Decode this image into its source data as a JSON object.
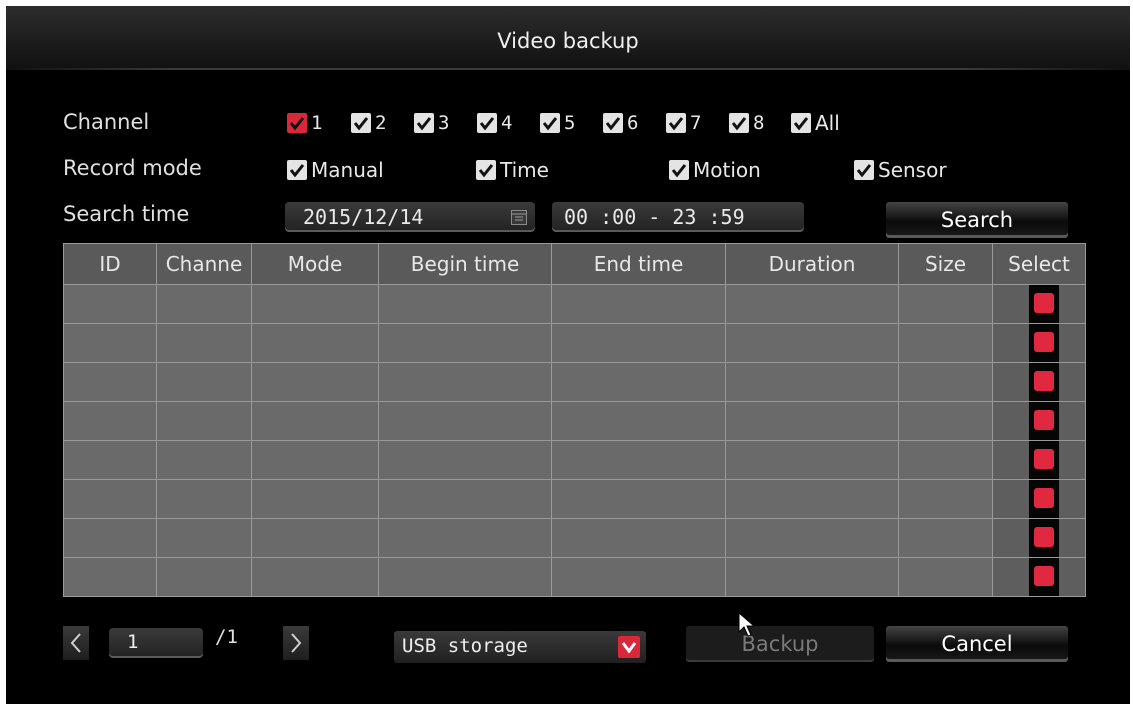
{
  "window": {
    "title": "Video backup"
  },
  "channel": {
    "label": "Channel",
    "items": [
      {
        "label": "1",
        "checked": true,
        "color": "#d8283a"
      },
      {
        "label": "2",
        "checked": true
      },
      {
        "label": "3",
        "checked": true
      },
      {
        "label": "4",
        "checked": true
      },
      {
        "label": "5",
        "checked": true
      },
      {
        "label": "6",
        "checked": true
      },
      {
        "label": "7",
        "checked": true
      },
      {
        "label": "8",
        "checked": true
      },
      {
        "label": "All",
        "checked": true
      }
    ]
  },
  "record_mode": {
    "label": "Record mode",
    "items": [
      {
        "label": "Manual",
        "checked": true
      },
      {
        "label": "Time",
        "checked": true
      },
      {
        "label": "Motion",
        "checked": true
      },
      {
        "label": "Sensor",
        "checked": true
      }
    ]
  },
  "search_time": {
    "label": "Search time",
    "date": "2015/12/14",
    "time_range": "00 :00 - 23 :59",
    "calendar_icon": "calendar-icon"
  },
  "search_button": "Search",
  "table": {
    "columns": [
      "ID",
      "Channe",
      "Mode",
      "Begin time",
      "End time",
      "Duration",
      "Size",
      "Select"
    ],
    "row_count": 8,
    "select_color": "#e02840"
  },
  "pagination": {
    "current_page": "1",
    "total": "/1",
    "prev_icon": "chevron-left-icon",
    "next_icon": "chevron-right-icon"
  },
  "storage": {
    "selected": "USB storage",
    "dropdown_icon": "chevron-down-icon"
  },
  "buttons": {
    "backup": "Backup",
    "cancel": "Cancel"
  },
  "colors": {
    "accent": "#d8283a",
    "background": "#000000",
    "grid": "#6a6a6a"
  }
}
